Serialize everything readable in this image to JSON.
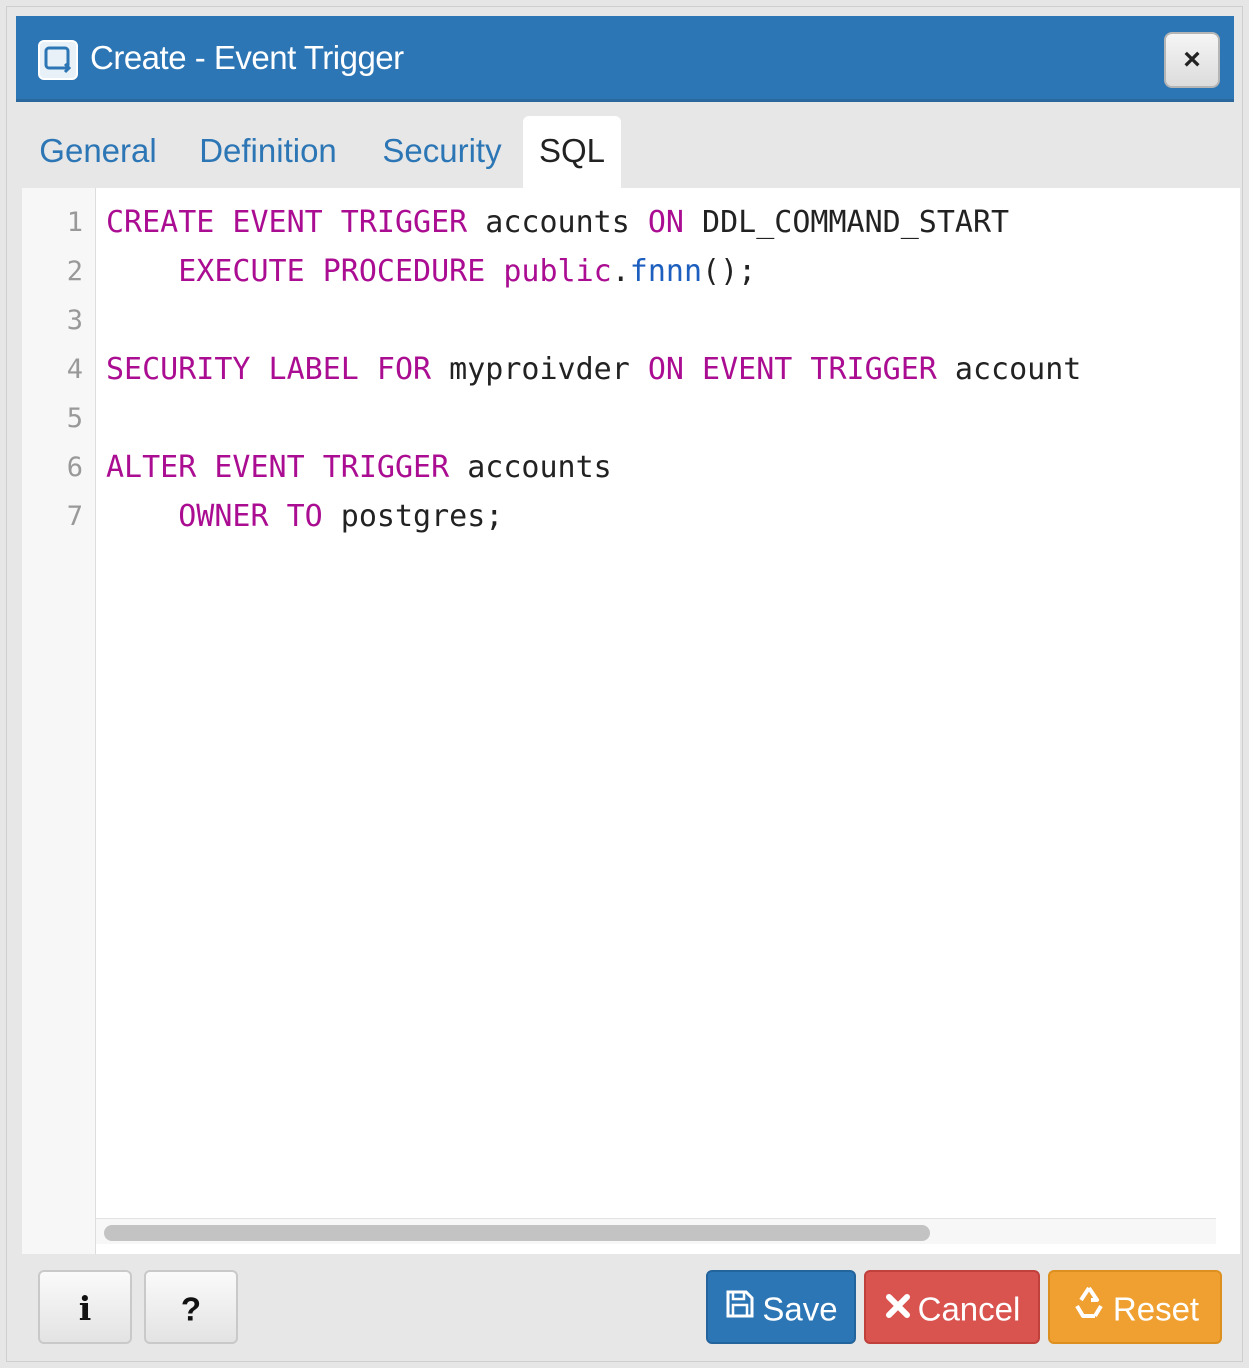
{
  "dialog": {
    "title": "Create - Event Trigger",
    "close_label": "×"
  },
  "tabs": [
    {
      "label": "General",
      "active": false
    },
    {
      "label": "Definition",
      "active": false
    },
    {
      "label": "Security",
      "active": false
    },
    {
      "label": "SQL",
      "active": true
    }
  ],
  "editor": {
    "line_numbers": [
      "1",
      "2",
      "3",
      "4",
      "5",
      "6",
      "7"
    ],
    "lines": [
      [
        {
          "t": "CREATE EVENT TRIGGER",
          "c": "kw"
        },
        {
          "t": " accounts ",
          "c": "ident"
        },
        {
          "t": "ON",
          "c": "kw"
        },
        {
          "t": " DDL_COMMAND_START",
          "c": "ident"
        }
      ],
      [
        {
          "t": "    ",
          "c": "ident"
        },
        {
          "t": "EXECUTE PROCEDURE",
          "c": "kw"
        },
        {
          "t": " ",
          "c": "ident"
        },
        {
          "t": "public",
          "c": "kw"
        },
        {
          "t": ".",
          "c": "ident"
        },
        {
          "t": "fnnn",
          "c": "fn"
        },
        {
          "t": "();",
          "c": "ident"
        }
      ],
      [],
      [
        {
          "t": "SECURITY LABEL FOR",
          "c": "kw"
        },
        {
          "t": " myproivder ",
          "c": "ident"
        },
        {
          "t": "ON EVENT TRIGGER",
          "c": "kw"
        },
        {
          "t": " account",
          "c": "ident"
        }
      ],
      [],
      [
        {
          "t": "ALTER EVENT TRIGGER",
          "c": "kw"
        },
        {
          "t": " accounts",
          "c": "ident"
        }
      ],
      [
        {
          "t": "    ",
          "c": "ident"
        },
        {
          "t": "OWNER TO",
          "c": "kw"
        },
        {
          "t": " postgres;",
          "c": "ident"
        }
      ]
    ]
  },
  "footer": {
    "info_label": "i",
    "help_label": "?",
    "save_label": "Save",
    "cancel_label": "Cancel",
    "reset_label": "Reset"
  },
  "colors": {
    "titlebar": "#2c76b5",
    "keyword": "#aa0d91",
    "function": "#1c5fbf",
    "save": "#2c76b5",
    "cancel": "#d9534f",
    "reset": "#f0a030"
  }
}
